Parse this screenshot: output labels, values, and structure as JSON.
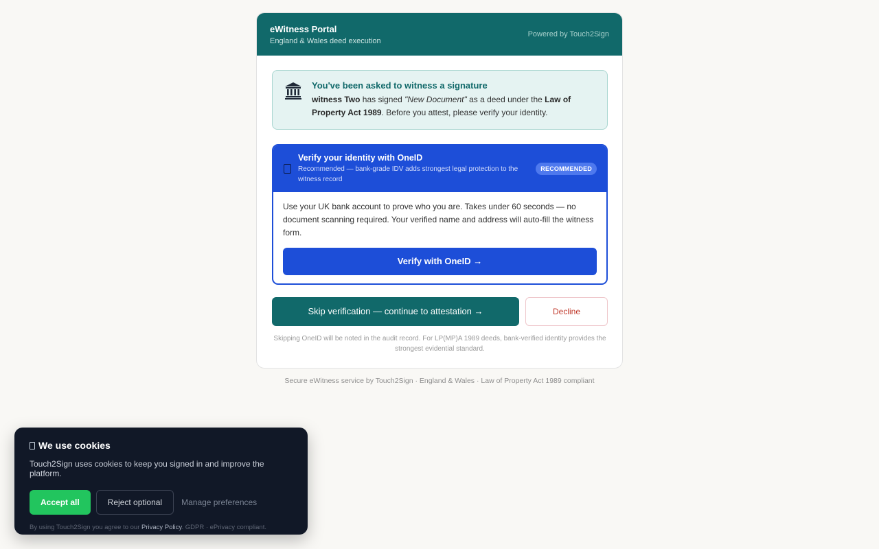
{
  "header": {
    "title": "eWitness Portal",
    "subtitle": "England & Wales deed execution",
    "powered_by": "Powered by Touch2Sign"
  },
  "notice": {
    "icon": "bank-building-icon",
    "title": "You've been asked to witness a signature",
    "signer": "witness Two",
    "has_signed": " has signed ",
    "document": "\"New Document\"",
    "as_deed": " as a deed under the ",
    "act": "Law of Property Act 1989",
    "tail": ". Before you attest, please verify your identity."
  },
  "oneid": {
    "icon": "phone-icon",
    "title": "Verify your identity with OneID",
    "subtitle": "Recommended — bank-grade IDV adds strongest legal protection to the witness record",
    "badge": "RECOMMENDED",
    "body": "Use your UK bank account to prove who you are. Takes under 60 seconds — no document scanning required. Your verified name and address will auto-fill the witness form.",
    "button": "Verify with OneID →"
  },
  "actions": {
    "skip": "Skip verification — continue to attestation →",
    "decline": "Decline",
    "note": "Skipping OneID will be noted in the audit record. For LP(MP)A 1989 deeds, bank-verified identity provides the strongest evidential standard."
  },
  "footer": "Secure eWitness service by Touch2Sign · England & Wales · Law of Property Act 1989 compliant",
  "cookie": {
    "title": "We use cookies",
    "text": "Touch2Sign uses cookies to keep you signed in and improve the platform.",
    "accept": "Accept all",
    "reject": "Reject optional",
    "manage": "Manage preferences",
    "legal_prefix": "By using Touch2Sign you agree to our ",
    "legal_link": "Privacy Policy",
    "legal_suffix": ". GDPR · ePrivacy compliant."
  },
  "colors": {
    "brand": "#11696a",
    "primary": "#1d4ed8",
    "accept": "#22c55e",
    "danger": "#c0392b",
    "cookie_bg": "#111827"
  }
}
